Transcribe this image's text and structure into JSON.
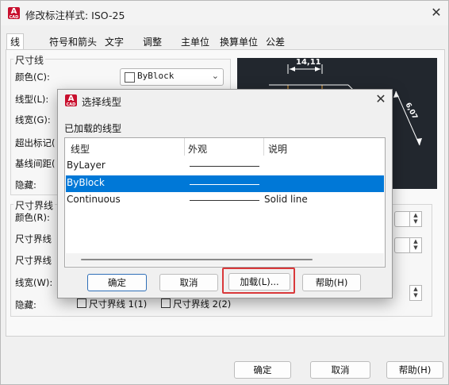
{
  "outer": {
    "title": "修改标注样式: ISO-25",
    "tabs": [
      "线",
      "符号和箭头",
      "文字",
      "调整",
      "主单位",
      "换算单位",
      "公差"
    ],
    "dim_lines_group": "尺寸线",
    "color_label": "颜色(C):",
    "color_value": "ByBlock",
    "linetype_label": "线型(L):",
    "lineweight_label": "线宽(G):",
    "extend_label": "超出标记(",
    "baseline_label": "基线间距(",
    "hide_label": "隐藏:",
    "ext_lines_group": "尺寸界线",
    "ext_color_label": "颜色(R):",
    "ext_linetype1_label": "尺寸界线",
    "ext_linetype2_label": "尺寸界线",
    "ext_lineweight_label": "线宽(W):",
    "ext_hide_label": "隐藏:",
    "ext_line1_check": "尺寸界线 1(1)",
    "ext_line2_check": "尺寸界线 2(2)",
    "preview_dimension": "14,11",
    "preview_dimension_right": "6,07",
    "ok": "确定",
    "cancel": "取消",
    "help": "帮助(H)"
  },
  "dialog": {
    "title": "选择线型",
    "section_label": "已加载的线型",
    "columns": [
      "线型",
      "外观",
      "说明"
    ],
    "rows": [
      {
        "name": "ByLayer",
        "description": "",
        "selected": false
      },
      {
        "name": "ByBlock",
        "description": "",
        "selected": true
      },
      {
        "name": "Continuous",
        "description": "Solid line",
        "selected": false
      }
    ],
    "ok": "确定",
    "cancel": "取消",
    "load": "加载(L)...",
    "help": "帮助(H)"
  },
  "colors": {
    "selection": "#0078d7",
    "highlight_frame": "#d9383a",
    "preview_bg": "#22272e",
    "preview_accent": "#e8a33c",
    "app_icon": "#c8102e"
  },
  "icons": [
    "autocad-app-icon",
    "close-icon",
    "chevron-down-icon",
    "spin-up-icon",
    "spin-down-icon"
  ]
}
